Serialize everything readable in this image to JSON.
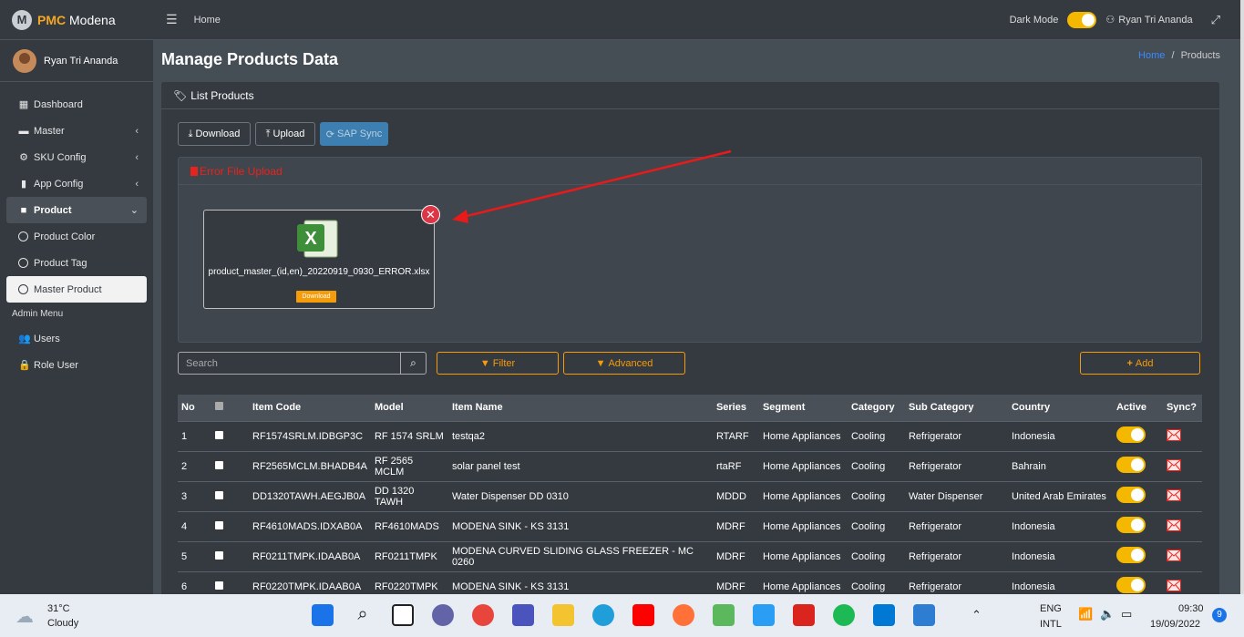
{
  "app": {
    "brand_strong": "PMC",
    "brand_rest": " Modena",
    "logo": "M",
    "user": "Ryan Tri Ananda"
  },
  "sidebar": {
    "items": [
      {
        "label": "Dashboard",
        "icon": "table-icon"
      },
      {
        "label": "Master",
        "icon": "car-icon"
      },
      {
        "label": "SKU Config",
        "icon": "gear-icon"
      },
      {
        "label": "App Config",
        "icon": "mobile-icon"
      },
      {
        "label": "Product",
        "icon": "briefcase-icon"
      },
      {
        "label": "Product Color"
      },
      {
        "label": "Product Tag"
      },
      {
        "label": "Master Product"
      }
    ],
    "admin_header": "Admin Menu",
    "admin_items": [
      {
        "label": "Users"
      },
      {
        "label": "Role User"
      }
    ]
  },
  "topbar": {
    "home": "Home",
    "dark_mode": "Dark Mode",
    "user": "Ryan Tri Ananda"
  },
  "page": {
    "title": "Manage Products Data",
    "bc_home": "Home",
    "bc_sep": "/",
    "bc_current": "Products"
  },
  "card": {
    "title": "List Products",
    "download": "Download",
    "upload": "Upload",
    "sap": "SAP Sync",
    "error_title": "Error File Upload",
    "file_name": "product_master_(id,en)_20220919_0930_ERROR.xlsx",
    "file_download": "Download",
    "search_placeholder": "Search",
    "filter": "Filter",
    "advanced": "Advanced",
    "add": "Add"
  },
  "table": {
    "headers": [
      "No",
      "",
      "Item Code",
      "Model",
      "Item Name",
      "Series",
      "Segment",
      "Category",
      "Sub Category",
      "Country",
      "Active",
      "Sync?"
    ],
    "rows": [
      [
        "1",
        "RF1574SRLM.IDBGP3C",
        "RF 1574 SRLM",
        "testqa2",
        "RTARF",
        "Home Appliances",
        "Cooling",
        "Refrigerator",
        "Indonesia"
      ],
      [
        "2",
        "RF2565MCLM.BHADB4A",
        "RF 2565 MCLM",
        "solar panel test",
        "rtaRF",
        "Home Appliances",
        "Cooling",
        "Refrigerator",
        "Bahrain"
      ],
      [
        "3",
        "DD1320TAWH.AEGJB0A",
        "DD 1320 TAWH",
        "Water Dispenser DD 0310",
        "MDDD",
        "Home Appliances",
        "Cooling",
        "Water Dispenser",
        "United Arab Emirates"
      ],
      [
        "4",
        "RF4610MADS.IDXAB0A",
        "RF4610MADS",
        "MODENA SINK - KS 3131",
        "MDRF",
        "Home Appliances",
        "Cooling",
        "Refrigerator",
        "Indonesia"
      ],
      [
        "5",
        "RF0211TMPK.IDAAB0A",
        "RF0211TMPK",
        "MODENA CURVED SLIDING GLASS FREEZER - MC 0260",
        "MDRF",
        "Home Appliances",
        "Cooling",
        "Refrigerator",
        "Indonesia"
      ],
      [
        "6",
        "RF0220TMPK.IDAAB0A",
        "RF0220TMPK",
        "MODENA SINK - KS 3131",
        "MDRF",
        "Home Appliances",
        "Cooling",
        "Refrigerator",
        "Indonesia"
      ]
    ]
  },
  "taskbar": {
    "temp": "31°C",
    "weather": "Cloudy",
    "lang1": "ENG",
    "lang2": "INTL",
    "time": "09:30",
    "date": "19/09/2022",
    "badge": "9"
  }
}
